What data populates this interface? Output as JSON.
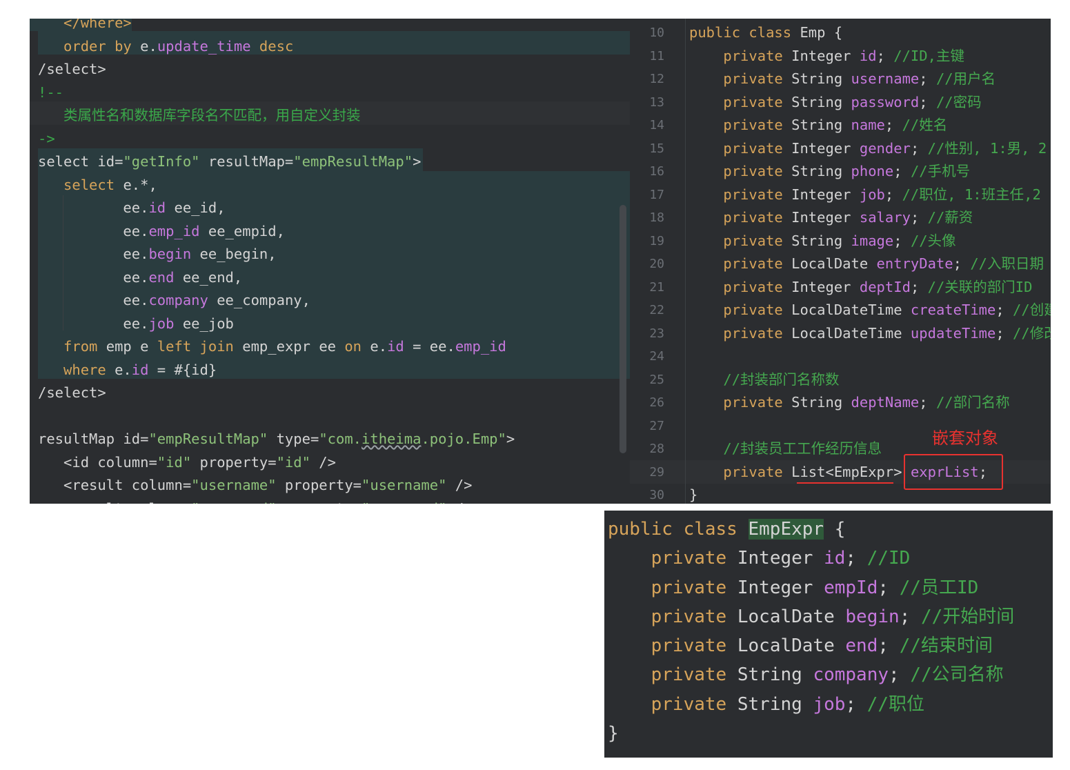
{
  "xml_panel": {
    "lines": [
      {
        "indent": "   ",
        "parts": [
          {
            "t": "</where>",
            "c": "kw2"
          }
        ]
      },
      {
        "indent": "   ",
        "parts": [
          {
            "t": "order by ",
            "c": "kw"
          },
          {
            "t": "e.",
            "c": "op"
          },
          {
            "t": "update_time",
            "c": "fld"
          },
          {
            "t": " desc",
            "c": "kw"
          }
        ]
      },
      {
        "indent": "",
        "parts": [
          {
            "t": "/select>",
            "c": "tag"
          }
        ]
      },
      {
        "indent": "",
        "parts": [
          {
            "t": "!--",
            "c": "cm"
          }
        ]
      },
      {
        "indent": "   ",
        "parts": [
          {
            "t": "类属性名和数据库字段名不匹配，用自定义封装",
            "c": "cm"
          }
        ]
      },
      {
        "indent": "",
        "parts": [
          {
            "t": "->",
            "c": "cm"
          }
        ]
      },
      {
        "indent": "",
        "parts": [
          {
            "t": "select id=",
            "c": "tag"
          },
          {
            "t": "\"getInfo\"",
            "c": "str"
          },
          {
            "t": " resultMap=",
            "c": "tag"
          },
          {
            "t": "\"empResultMap\"",
            "c": "str"
          },
          {
            "t": ">",
            "c": "tag"
          }
        ]
      },
      {
        "indent": "   ",
        "parts": [
          {
            "t": "select ",
            "c": "kw"
          },
          {
            "t": "e.*,",
            "c": "op"
          }
        ]
      },
      {
        "indent": "          ",
        "parts": [
          {
            "t": "ee.",
            "c": "op"
          },
          {
            "t": "id",
            "c": "fld"
          },
          {
            "t": " ee_id,",
            "c": "op"
          }
        ]
      },
      {
        "indent": "          ",
        "parts": [
          {
            "t": "ee.",
            "c": "op"
          },
          {
            "t": "emp_id",
            "c": "fld"
          },
          {
            "t": " ee_empid,",
            "c": "op"
          }
        ]
      },
      {
        "indent": "          ",
        "parts": [
          {
            "t": "ee.",
            "c": "op"
          },
          {
            "t": "begin",
            "c": "fld"
          },
          {
            "t": " ee_begin,",
            "c": "op"
          }
        ]
      },
      {
        "indent": "          ",
        "parts": [
          {
            "t": "ee.",
            "c": "op"
          },
          {
            "t": "end",
            "c": "fld"
          },
          {
            "t": " ee_end,",
            "c": "op"
          }
        ]
      },
      {
        "indent": "          ",
        "parts": [
          {
            "t": "ee.",
            "c": "op"
          },
          {
            "t": "company",
            "c": "fld"
          },
          {
            "t": " ee_company,",
            "c": "op"
          }
        ]
      },
      {
        "indent": "          ",
        "parts": [
          {
            "t": "ee.",
            "c": "op"
          },
          {
            "t": "job",
            "c": "fld"
          },
          {
            "t": " ee_job",
            "c": "op"
          }
        ]
      },
      {
        "indent": "   ",
        "parts": [
          {
            "t": "from ",
            "c": "kw"
          },
          {
            "t": "emp e ",
            "c": "op"
          },
          {
            "t": "left join ",
            "c": "kw"
          },
          {
            "t": "emp_expr ee ",
            "c": "op"
          },
          {
            "t": "on ",
            "c": "kw"
          },
          {
            "t": "e.",
            "c": "op"
          },
          {
            "t": "id",
            "c": "fld"
          },
          {
            "t": " = ee.",
            "c": "op"
          },
          {
            "t": "emp_id",
            "c": "fld"
          }
        ]
      },
      {
        "indent": "   ",
        "parts": [
          {
            "t": "where ",
            "c": "kw"
          },
          {
            "t": "e.",
            "c": "op"
          },
          {
            "t": "id",
            "c": "fld"
          },
          {
            "t": " = #{id}",
            "c": "op"
          }
        ]
      },
      {
        "indent": "",
        "parts": [
          {
            "t": "/select>",
            "c": "tag"
          }
        ]
      },
      {
        "indent": "",
        "parts": []
      },
      {
        "indent": "",
        "parts": [
          {
            "t": "resultMap id=",
            "c": "tag"
          },
          {
            "t": "\"empResultMap\"",
            "c": "str"
          },
          {
            "t": " type=",
            "c": "tag"
          },
          {
            "t": "\"com.",
            "c": "str"
          },
          {
            "t": "itheima",
            "c": "str uline"
          },
          {
            "t": ".pojo.Emp\"",
            "c": "str"
          },
          {
            "t": ">",
            "c": "tag"
          }
        ]
      },
      {
        "indent": "   ",
        "parts": [
          {
            "t": "<id column=",
            "c": "tag"
          },
          {
            "t": "\"id\"",
            "c": "str"
          },
          {
            "t": " property=",
            "c": "tag"
          },
          {
            "t": "\"id\"",
            "c": "str"
          },
          {
            "t": " />",
            "c": "tag"
          }
        ]
      },
      {
        "indent": "   ",
        "parts": [
          {
            "t": "<result column=",
            "c": "tag"
          },
          {
            "t": "\"username\"",
            "c": "str"
          },
          {
            "t": " property=",
            "c": "tag"
          },
          {
            "t": "\"username\"",
            "c": "str"
          },
          {
            "t": " />",
            "c": "tag"
          }
        ]
      },
      {
        "indent": "   ",
        "parts": [
          {
            "t": "<result column=",
            "c": "tag"
          },
          {
            "t": "\"password\"",
            "c": "str"
          },
          {
            "t": " property=",
            "c": "tag"
          },
          {
            "t": "\"password\"",
            "c": "str"
          },
          {
            "t": " />",
            "c": "tag"
          }
        ]
      }
    ]
  },
  "emp_panel": {
    "line_numbers": [
      "10",
      "11",
      "12",
      "13",
      "14",
      "15",
      "16",
      "17",
      "18",
      "19",
      "20",
      "21",
      "22",
      "23",
      "24",
      "25",
      "26",
      "27",
      "28",
      "29",
      "30"
    ],
    "lines": [
      {
        "indent": "",
        "parts": [
          {
            "t": "public class ",
            "c": "kw"
          },
          {
            "t": "Emp {",
            "c": "op"
          }
        ]
      },
      {
        "indent": "    ",
        "parts": [
          {
            "t": "private ",
            "c": "kw"
          },
          {
            "t": "Integer ",
            "c": "op"
          },
          {
            "t": "id",
            "c": "fld"
          },
          {
            "t": "; ",
            "c": "op"
          },
          {
            "t": "//ID,主键",
            "c": "cmt"
          }
        ]
      },
      {
        "indent": "    ",
        "parts": [
          {
            "t": "private ",
            "c": "kw"
          },
          {
            "t": "String ",
            "c": "op"
          },
          {
            "t": "username",
            "c": "fld"
          },
          {
            "t": "; ",
            "c": "op"
          },
          {
            "t": "//用户名",
            "c": "cmt"
          }
        ]
      },
      {
        "indent": "    ",
        "parts": [
          {
            "t": "private ",
            "c": "kw"
          },
          {
            "t": "String ",
            "c": "op"
          },
          {
            "t": "password",
            "c": "fld"
          },
          {
            "t": "; ",
            "c": "op"
          },
          {
            "t": "//密码",
            "c": "cmt"
          }
        ]
      },
      {
        "indent": "    ",
        "parts": [
          {
            "t": "private ",
            "c": "kw"
          },
          {
            "t": "String ",
            "c": "op"
          },
          {
            "t": "name",
            "c": "fld"
          },
          {
            "t": "; ",
            "c": "op"
          },
          {
            "t": "//姓名",
            "c": "cmt"
          }
        ]
      },
      {
        "indent": "    ",
        "parts": [
          {
            "t": "private ",
            "c": "kw"
          },
          {
            "t": "Integer ",
            "c": "op"
          },
          {
            "t": "gender",
            "c": "fld"
          },
          {
            "t": "; ",
            "c": "op"
          },
          {
            "t": "//性别, 1:男, 2",
            "c": "cmt"
          }
        ]
      },
      {
        "indent": "    ",
        "parts": [
          {
            "t": "private ",
            "c": "kw"
          },
          {
            "t": "String ",
            "c": "op"
          },
          {
            "t": "phone",
            "c": "fld"
          },
          {
            "t": "; ",
            "c": "op"
          },
          {
            "t": "//手机号",
            "c": "cmt"
          }
        ]
      },
      {
        "indent": "    ",
        "parts": [
          {
            "t": "private ",
            "c": "kw"
          },
          {
            "t": "Integer ",
            "c": "op"
          },
          {
            "t": "job",
            "c": "fld"
          },
          {
            "t": "; ",
            "c": "op"
          },
          {
            "t": "//职位, 1:班主任,2",
            "c": "cmt"
          }
        ]
      },
      {
        "indent": "    ",
        "parts": [
          {
            "t": "private ",
            "c": "kw"
          },
          {
            "t": "Integer ",
            "c": "op"
          },
          {
            "t": "salary",
            "c": "fld"
          },
          {
            "t": "; ",
            "c": "op"
          },
          {
            "t": "//薪资",
            "c": "cmt"
          }
        ]
      },
      {
        "indent": "    ",
        "parts": [
          {
            "t": "private ",
            "c": "kw"
          },
          {
            "t": "String ",
            "c": "op"
          },
          {
            "t": "image",
            "c": "fld"
          },
          {
            "t": "; ",
            "c": "op"
          },
          {
            "t": "//头像",
            "c": "cmt"
          }
        ]
      },
      {
        "indent": "    ",
        "parts": [
          {
            "t": "private ",
            "c": "kw"
          },
          {
            "t": "LocalDate ",
            "c": "op"
          },
          {
            "t": "entryDate",
            "c": "fld"
          },
          {
            "t": "; ",
            "c": "op"
          },
          {
            "t": "//入职日期",
            "c": "cmt"
          }
        ]
      },
      {
        "indent": "    ",
        "parts": [
          {
            "t": "private ",
            "c": "kw"
          },
          {
            "t": "Integer ",
            "c": "op"
          },
          {
            "t": "deptId",
            "c": "fld"
          },
          {
            "t": "; ",
            "c": "op"
          },
          {
            "t": "//关联的部门ID",
            "c": "cmt"
          }
        ]
      },
      {
        "indent": "    ",
        "parts": [
          {
            "t": "private ",
            "c": "kw"
          },
          {
            "t": "LocalDateTime ",
            "c": "op"
          },
          {
            "t": "createTime",
            "c": "fld"
          },
          {
            "t": "; ",
            "c": "op"
          },
          {
            "t": "//创建",
            "c": "cmt"
          }
        ]
      },
      {
        "indent": "    ",
        "parts": [
          {
            "t": "private ",
            "c": "kw"
          },
          {
            "t": "LocalDateTime ",
            "c": "op"
          },
          {
            "t": "updateTime",
            "c": "fld"
          },
          {
            "t": "; ",
            "c": "op"
          },
          {
            "t": "//修改",
            "c": "cmt"
          }
        ]
      },
      {
        "indent": "",
        "parts": []
      },
      {
        "indent": "    ",
        "parts": [
          {
            "t": "//封装部门名称数",
            "c": "cmt"
          }
        ]
      },
      {
        "indent": "    ",
        "parts": [
          {
            "t": "private ",
            "c": "kw"
          },
          {
            "t": "String ",
            "c": "op"
          },
          {
            "t": "deptName",
            "c": "fld"
          },
          {
            "t": "; ",
            "c": "op"
          },
          {
            "t": "//部门名称",
            "c": "cmt"
          }
        ]
      },
      {
        "indent": "",
        "parts": []
      },
      {
        "indent": "    ",
        "parts": [
          {
            "t": "//封装员工工作经历信息",
            "c": "cmt"
          }
        ]
      },
      {
        "indent": "    ",
        "parts": [
          {
            "t": "private ",
            "c": "kw"
          },
          {
            "t": "List<",
            "c": "op"
          },
          {
            "t": "EmpExpr",
            "c": "op"
          },
          {
            "t": "> ",
            "c": "op"
          },
          {
            "t": "exprList",
            "c": "fld"
          },
          {
            "t": ";",
            "c": "op"
          }
        ]
      },
      {
        "indent": "",
        "parts": [
          {
            "t": "}",
            "c": "op"
          }
        ]
      }
    ],
    "annotation": "嵌套对象",
    "annotation_color": "#e8322f"
  },
  "expr_panel": {
    "lines": [
      {
        "indent": "",
        "parts": [
          {
            "t": "public class ",
            "c": "kw"
          },
          {
            "t": "EmpExpr",
            "c": "op hlword"
          },
          {
            "t": " {",
            "c": "op"
          }
        ]
      },
      {
        "indent": "    ",
        "parts": [
          {
            "t": "private ",
            "c": "kw"
          },
          {
            "t": "Integer ",
            "c": "op"
          },
          {
            "t": "id",
            "c": "fld"
          },
          {
            "t": "; ",
            "c": "op"
          },
          {
            "t": "//ID",
            "c": "cmt"
          }
        ]
      },
      {
        "indent": "    ",
        "parts": [
          {
            "t": "private ",
            "c": "kw"
          },
          {
            "t": "Integer ",
            "c": "op"
          },
          {
            "t": "empId",
            "c": "fld"
          },
          {
            "t": "; ",
            "c": "op"
          },
          {
            "t": "//员工ID",
            "c": "cmt"
          }
        ]
      },
      {
        "indent": "    ",
        "parts": [
          {
            "t": "private ",
            "c": "kw"
          },
          {
            "t": "LocalDate ",
            "c": "op"
          },
          {
            "t": "begin",
            "c": "fld"
          },
          {
            "t": "; ",
            "c": "op"
          },
          {
            "t": "//开始时间",
            "c": "cmt"
          }
        ]
      },
      {
        "indent": "    ",
        "parts": [
          {
            "t": "private ",
            "c": "kw"
          },
          {
            "t": "LocalDate ",
            "c": "op"
          },
          {
            "t": "end",
            "c": "fld"
          },
          {
            "t": "; ",
            "c": "op"
          },
          {
            "t": "//结束时间",
            "c": "cmt"
          }
        ]
      },
      {
        "indent": "    ",
        "parts": [
          {
            "t": "private ",
            "c": "kw"
          },
          {
            "t": "String ",
            "c": "op"
          },
          {
            "t": "company",
            "c": "fld"
          },
          {
            "t": "; ",
            "c": "op"
          },
          {
            "t": "//公司名称",
            "c": "cmt"
          }
        ]
      },
      {
        "indent": "    ",
        "parts": [
          {
            "t": "private ",
            "c": "kw"
          },
          {
            "t": "String ",
            "c": "op"
          },
          {
            "t": "job",
            "c": "fld"
          },
          {
            "t": "; ",
            "c": "op"
          },
          {
            "t": "//职位",
            "c": "cmt"
          }
        ]
      },
      {
        "indent": "",
        "parts": [
          {
            "t": "}",
            "c": "op"
          }
        ]
      }
    ]
  },
  "colors": {
    "panel_bg": "#2b2d30",
    "keyword": "#d7a45a",
    "string": "#8ec27a",
    "comment": "#45a84f",
    "field": "#c678dd",
    "highlight_box": "#e8322f"
  }
}
